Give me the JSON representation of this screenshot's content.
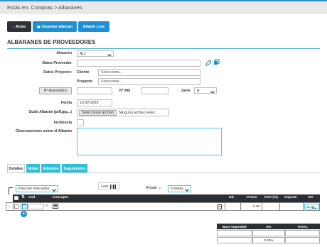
{
  "breadcrumb": "Estás en: Compras > Albaranes",
  "toolbar": {
    "back_label": "Atrás",
    "save_label": "Guardar albaran",
    "lot_label": "Añadir Lote"
  },
  "section_title": "ALBARANES DE PROVEEDORES",
  "form": {
    "almacen_label": "Almacén",
    "almacen_value": "AL1",
    "proveedor_label": "Datos Proveedor",
    "proyecto_label": "Datos Proyecto:",
    "cliente_label": "Cliente",
    "cliente_placeholder": "Selecciona...",
    "proyecto_sub_label": "Proyecto",
    "proyecto_placeholder": "Selecciona...",
    "auto_button_label": "Nº Automático",
    "alb_label": "Nº Alb",
    "serie_label": "Serie",
    "serie_value": "A",
    "fecha_label": "Fecha",
    "fecha_value": "13-02-2023",
    "subir_label": "Subir Albarán (pdf,jpg...)",
    "file_button_label": "Seleccionar archivo",
    "file_status": "Ninguno archivo selec.",
    "incidencia_label": "Incidencia",
    "observaciones_label": "Observaciones sobre el Albarán"
  },
  "tabs": [
    "Detalles",
    "Notas",
    "Adjuntos",
    "Seguimiento"
  ],
  "lines": {
    "marked_select": "Para los marcados",
    "leer_label": "Leer",
    "add_label": "Añadir",
    "lines_select": "5 lineas"
  },
  "table": {
    "headers": {
      "cod": "Cod",
      "concepto": "Concepto",
      "ud": "Ud.",
      "precio": "Precio",
      "dto": "DTO (%)",
      "importe": "Importe",
      "iva": "IVA"
    },
    "row": {
      "precio": "0.00",
      "iva": "21.00"
    }
  },
  "totals": {
    "headers": [
      "Base Imponible",
      "IVA",
      "TOTAL"
    ],
    "iva_percent": "0.00%"
  },
  "colors": {
    "accent": "#1f8fd2",
    "tab_cyan": "#2ec0d8",
    "dark": "#2b2f33"
  }
}
